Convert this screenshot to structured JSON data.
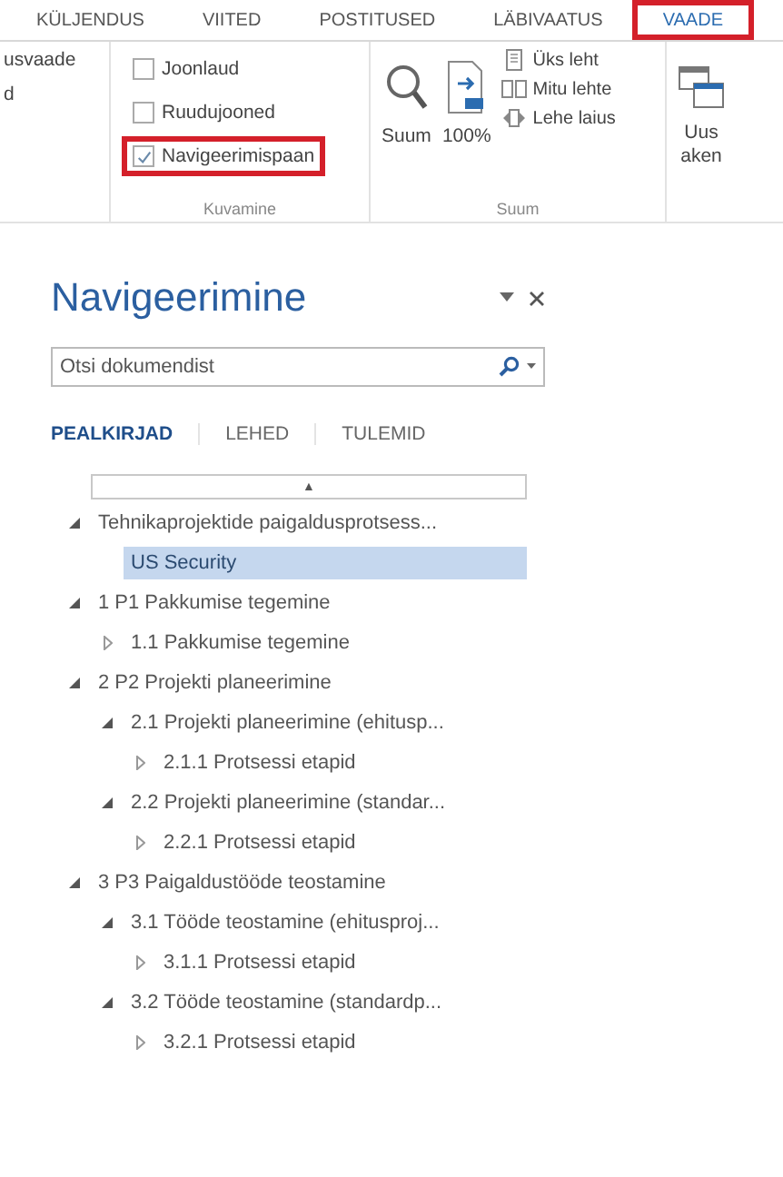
{
  "ribbon": {
    "tabs": [
      {
        "label": "KÜLJENDUS",
        "selected": false,
        "highlighted": false
      },
      {
        "label": "VIITED",
        "selected": false,
        "highlighted": false
      },
      {
        "label": "POSTITUSED",
        "selected": false,
        "highlighted": false
      },
      {
        "label": "LÄBIVAATUS",
        "selected": false,
        "highlighted": false
      },
      {
        "label": "VAADE",
        "selected": true,
        "highlighted": true
      }
    ],
    "cut_items": [
      "usvaade",
      "d"
    ],
    "show_group": {
      "label": "Kuvamine",
      "options": [
        {
          "label": "Joonlaud",
          "checked": false,
          "highlighted": false
        },
        {
          "label": "Ruudujooned",
          "checked": false,
          "highlighted": false
        },
        {
          "label": "Navigeerimispaan",
          "checked": true,
          "highlighted": true
        }
      ]
    },
    "zoom_group": {
      "label": "Suum",
      "buttons": [
        "Suum",
        "100%"
      ],
      "page_options": [
        "Üks leht",
        "Mitu lehte",
        "Lehe laius"
      ]
    },
    "window_button": [
      "Uus",
      "aken"
    ]
  },
  "pane": {
    "title": "Navigeerimine",
    "search": {
      "placeholder": "Otsi dokumendist"
    },
    "tabs": [
      {
        "label": "PEALKIRJAD",
        "selected": true
      },
      {
        "label": "LEHED",
        "selected": false
      },
      {
        "label": "TULEMID",
        "selected": false
      }
    ],
    "scroll_up": "▲",
    "tree": [
      {
        "label": "Tehnikaprojektide paigaldusprotsess...",
        "expanded": true,
        "selected": false,
        "children": [
          {
            "label": "US Security",
            "selected": true
          }
        ]
      },
      {
        "label": "1 P1 Pakkumise tegemine",
        "expanded": true,
        "selected": false,
        "children": [
          {
            "label": "1.1 Pakkumise tegemine",
            "expanded": false,
            "selected": false
          }
        ]
      },
      {
        "label": "2 P2 Projekti planeerimine",
        "expanded": true,
        "selected": false,
        "children": [
          {
            "label": "2.1 Projekti planeerimine (ehitusp...",
            "expanded": true,
            "selected": false,
            "children": [
              {
                "label": "2.1.1 Protsessi etapid",
                "expanded": false,
                "selected": false
              }
            ]
          },
          {
            "label": "2.2 Projekti planeerimine (standar...",
            "expanded": true,
            "selected": false,
            "children": [
              {
                "label": "2.2.1 Protsessi etapid",
                "expanded": false,
                "selected": false
              }
            ]
          }
        ]
      },
      {
        "label": "3 P3 Paigaldustööde teostamine",
        "expanded": true,
        "selected": false,
        "children": [
          {
            "label": "3.1 Tööde teostamine (ehitusproj...",
            "expanded": true,
            "selected": false,
            "children": [
              {
                "label": "3.1.1 Protsessi etapid",
                "expanded": false,
                "selected": false
              }
            ]
          },
          {
            "label": "3.2 Tööde teostamine (standardp...",
            "expanded": true,
            "selected": false,
            "children": [
              {
                "label": "3.2.1 Protsessi etapid",
                "expanded": false,
                "selected": false
              }
            ]
          }
        ]
      }
    ]
  }
}
